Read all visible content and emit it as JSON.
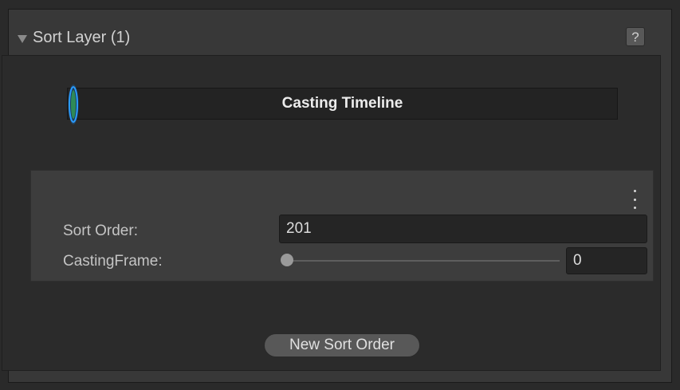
{
  "header": {
    "title": "Sort Layer (1)",
    "help_label": "?"
  },
  "timeline": {
    "title": "Casting Timeline"
  },
  "properties": {
    "sort_order_label": "Sort Order:",
    "sort_order_value": "201",
    "casting_frame_label": "CastingFrame:",
    "casting_frame_value": "0",
    "casting_frame_slider": 0
  },
  "actions": {
    "new_sort_order_label": "New Sort Order"
  },
  "icons": {
    "foldout": "triangle-down-icon",
    "help": "question-icon",
    "menu": "kebab-menu-icon",
    "handle": "timeline-handle-icon"
  },
  "colors": {
    "panel_bg": "#383838",
    "inner_bg": "#2b2b2b",
    "field_bg": "#252525",
    "handle_glow": "#1f8fe6",
    "handle_fill": "#2e8b57"
  }
}
